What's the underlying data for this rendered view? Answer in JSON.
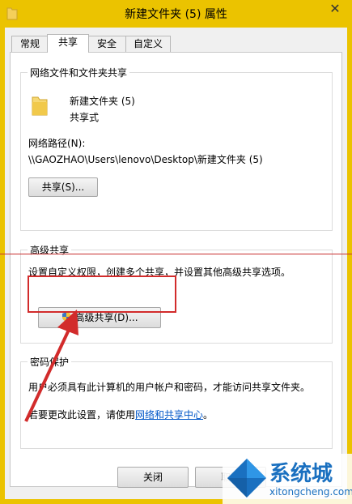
{
  "window": {
    "title": "新建文件夹 (5) 属性",
    "close_symbol": "✕"
  },
  "tabs": [
    {
      "label": "常规"
    },
    {
      "label": "共享"
    },
    {
      "label": "安全"
    },
    {
      "label": "自定义"
    }
  ],
  "network_share": {
    "group_title": "网络文件和文件夹共享",
    "folder_name": "新建文件夹 (5)",
    "share_status": "共享式",
    "path_label": "网络路径(N):",
    "path_value": "\\\\GAOZHAO\\Users\\lenovo\\Desktop\\新建文件夹 (5)",
    "share_button": "共享(S)..."
  },
  "advanced_share": {
    "group_title": "高级共享",
    "description": "设置自定义权限，创建多个共享，并设置其他高级共享选项。",
    "button": "高级共享(D)..."
  },
  "password_protect": {
    "group_title": "密码保护",
    "line1": "用户必须具有此计算机的用户帐户和密码，才能访问共享文件夹。",
    "line2_prefix": "若要更改此设置，请使用",
    "line2_link": "网络和共享中心",
    "line2_suffix": "。"
  },
  "footer": {
    "close_button": "关闭",
    "cancel_button": "取消"
  },
  "watermark": {
    "text": "系统城",
    "url": "xitongcheng.com"
  },
  "colors": {
    "titlebar": "#ebc300",
    "highlight_red": "#d22b2b",
    "link": "#0056c8"
  }
}
